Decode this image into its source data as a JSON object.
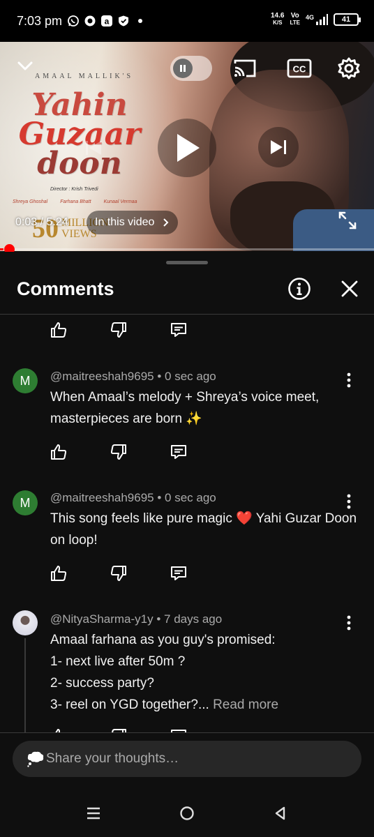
{
  "status_bar": {
    "time": "7:03 pm",
    "net_speed_value": "14.6",
    "net_speed_unit": "K/S",
    "volte_top": "Vo",
    "volte_bottom": "LTE",
    "network": "4G",
    "battery": "41",
    "icons": [
      "whatsapp-icon",
      "circle-app-icon",
      "a-app-icon",
      "shield-icon",
      "dot-icon"
    ]
  },
  "player": {
    "thumbnail_artist": "AMAAL MALLIK'S",
    "thumbnail_title_lines": [
      "Yahin",
      "Guzaar",
      "doon"
    ],
    "thumbnail_director": "Director : Krish Trivedi",
    "thumbnail_credits": [
      "Shreya Ghoshal",
      "Farhana Bhatt",
      "Kunaal Vermaa"
    ],
    "thumbnail_views_number": "50",
    "thumbnail_views_line1": "MILLION",
    "thumbnail_views_line2": "VIEWS",
    "current_time": "0:03",
    "separator": " / ",
    "duration": "5:24",
    "in_this_video_label": "In this video",
    "progress_fraction": 0.01,
    "accent": "#ff0000"
  },
  "comments_panel": {
    "title": "Comments",
    "comments": [
      {
        "avatar_letter": "M",
        "author": "@maitreeshah9695",
        "age": "0 sec ago",
        "text": "When Amaal’s melody + Shreya’s voice meet, masterpieces are born ✨"
      },
      {
        "avatar_letter": "M",
        "author": "@maitreeshah9695",
        "age": "0 sec ago",
        "text": "This song feels like pure magic ❤️ Yahi Guzar Doon on loop!"
      },
      {
        "author": "@NityaSharma-y1y",
        "age": "7 days ago",
        "lines": [
          "Amaal farhana as you guy's promised:",
          "1- next live after 50m ?",
          "2- success party?",
          "3- reel on YGD together?..."
        ],
        "read_more": "Read more"
      }
    ],
    "composer_placeholder": "Share your thoughts…"
  },
  "colors": {
    "background": "#0f0f0f",
    "avatar_green": "#2e7d32",
    "secondary_text": "#aaaaaa"
  }
}
